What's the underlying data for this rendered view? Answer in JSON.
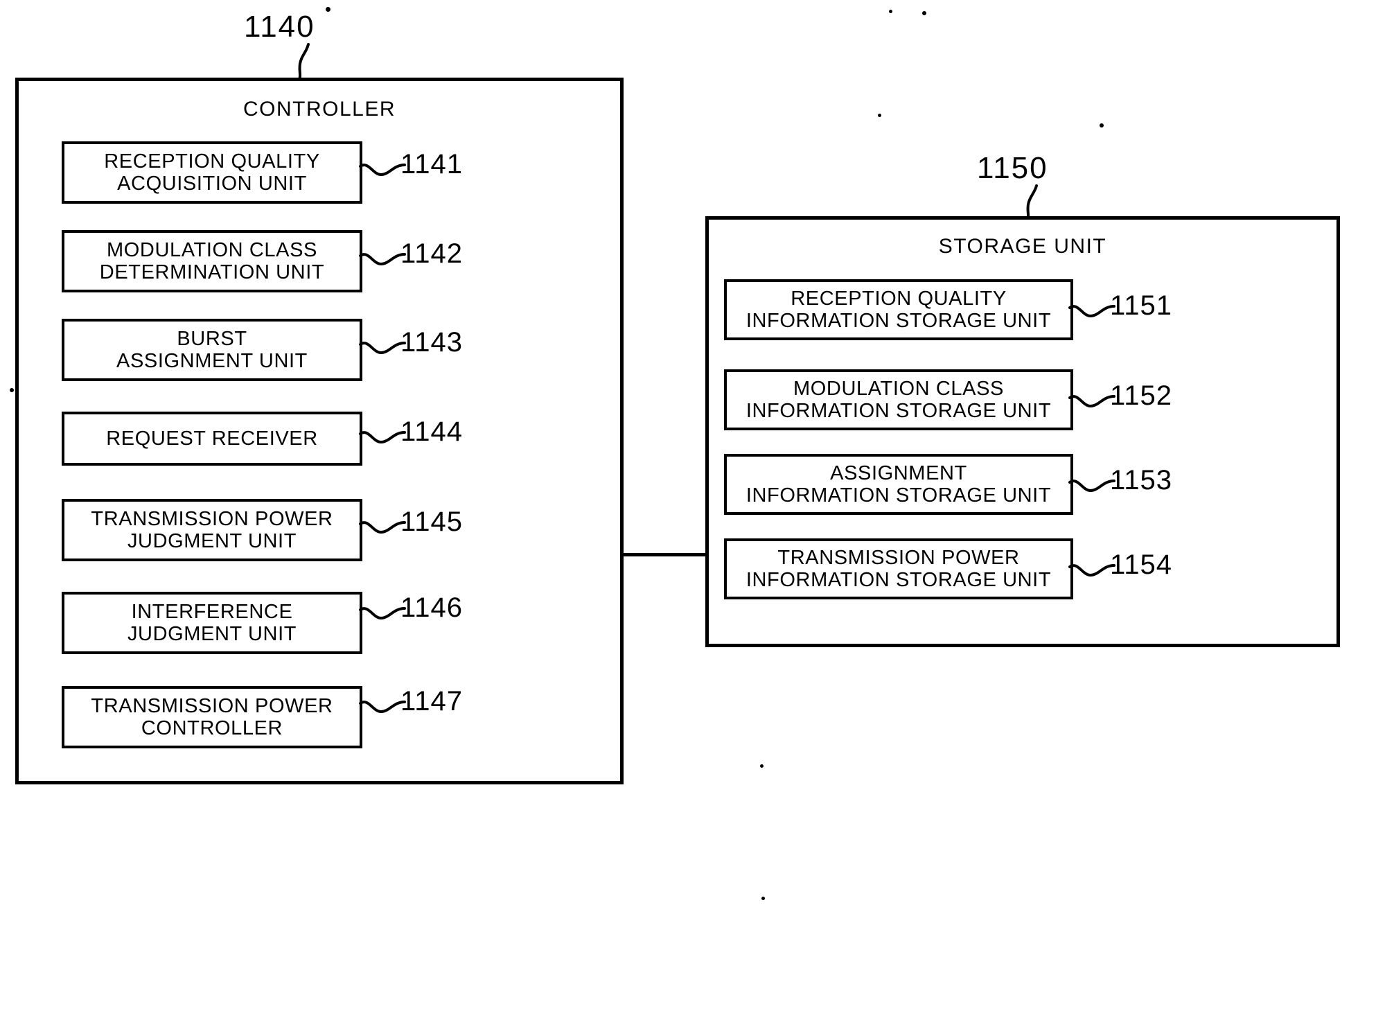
{
  "figure": {
    "type": "patent-block-diagram",
    "background_color": "#ffffff",
    "line_color": "#000000"
  },
  "controller": {
    "ref": "1140",
    "title": "CONTROLLER",
    "units": [
      {
        "ref": "1141",
        "label": "RECEPTION QUALITY\nACQUISITION UNIT"
      },
      {
        "ref": "1142",
        "label": "MODULATION CLASS\nDETERMINATION UNIT"
      },
      {
        "ref": "1143",
        "label": "BURST\nASSIGNMENT UNIT"
      },
      {
        "ref": "1144",
        "label": "REQUEST RECEIVER"
      },
      {
        "ref": "1145",
        "label": "TRANSMISSION POWER\nJUDGMENT UNIT"
      },
      {
        "ref": "1146",
        "label": "INTERFERENCE\nJUDGMENT UNIT"
      },
      {
        "ref": "1147",
        "label": "TRANSMISSION POWER\nCONTROLLER"
      }
    ]
  },
  "storage": {
    "ref": "1150",
    "title": "STORAGE UNIT",
    "units": [
      {
        "ref": "1151",
        "label": "RECEPTION QUALITY\nINFORMATION STORAGE UNIT"
      },
      {
        "ref": "1152",
        "label": "MODULATION CLASS\nINFORMATION STORAGE UNIT"
      },
      {
        "ref": "1153",
        "label": "ASSIGNMENT\nINFORMATION STORAGE UNIT"
      },
      {
        "ref": "1154",
        "label": "TRANSMISSION POWER\nINFORMATION STORAGE UNIT"
      }
    ]
  }
}
